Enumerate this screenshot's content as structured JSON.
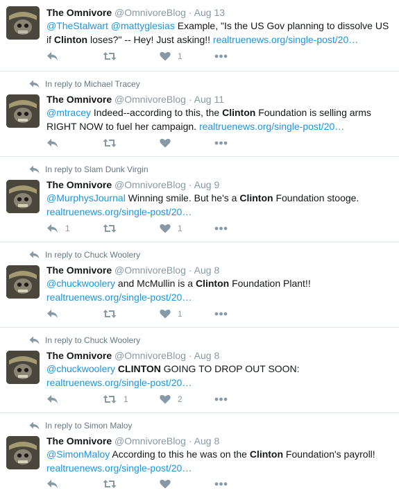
{
  "tweets": [
    {
      "reply_label": "",
      "name": "The Omnivore",
      "handle": "@OmnivoreBlog",
      "date": "Aug 13",
      "segments": [
        {
          "t": "@TheStalwart",
          "k": "mention"
        },
        {
          "t": " ",
          "k": "text"
        },
        {
          "t": "@mattyglesias",
          "k": "mention"
        },
        {
          "t": " Example, \"Is the US Gov planning to dissolve US if ",
          "k": "text"
        },
        {
          "t": "Clinton",
          "k": "bold"
        },
        {
          "t": " loses?\" -- Hey! Just asking!! ",
          "k": "text"
        },
        {
          "t": "realtruenews.org/single-post/20…",
          "k": "url"
        }
      ],
      "reply_count": "",
      "retweet_count": "",
      "like_count": "1"
    },
    {
      "reply_label": "In reply to Michael Tracey",
      "name": "The Omnivore",
      "handle": "@OmnivoreBlog",
      "date": "Aug 11",
      "segments": [
        {
          "t": "@mtracey",
          "k": "mention"
        },
        {
          "t": " Indeed--according to this, the ",
          "k": "text"
        },
        {
          "t": "Clinton",
          "k": "bold"
        },
        {
          "t": " Foundation is selling arms RIGHT NOW to fuel her campaign. ",
          "k": "text"
        },
        {
          "t": "realtruenews.org/single-post/20…",
          "k": "url"
        }
      ],
      "reply_count": "",
      "retweet_count": "",
      "like_count": ""
    },
    {
      "reply_label": "In reply to Slam Dunk Virgin",
      "name": "The Omnivore",
      "handle": "@OmnivoreBlog",
      "date": "Aug 9",
      "segments": [
        {
          "t": "@MurphysJournal",
          "k": "mention"
        },
        {
          "t": " Winning smile. But he's a ",
          "k": "text"
        },
        {
          "t": "Clinton",
          "k": "bold"
        },
        {
          "t": " Foundation stooge. ",
          "k": "text"
        },
        {
          "t": "realtruenews.org/single-post/20…",
          "k": "url"
        }
      ],
      "reply_count": "1",
      "retweet_count": "",
      "like_count": "1"
    },
    {
      "reply_label": "In reply to Chuck Woolery",
      "name": "The Omnivore",
      "handle": "@OmnivoreBlog",
      "date": "Aug 8",
      "segments": [
        {
          "t": "@chuckwoolery",
          "k": "mention"
        },
        {
          "t": " and McMullin is a ",
          "k": "text"
        },
        {
          "t": "Clinton",
          "k": "bold"
        },
        {
          "t": " Foundation Plant!! ",
          "k": "text"
        },
        {
          "t": "realtruenews.org/single-post/20…",
          "k": "url"
        }
      ],
      "reply_count": "",
      "retweet_count": "",
      "like_count": "1"
    },
    {
      "reply_label": "In reply to Chuck Woolery",
      "name": "The Omnivore",
      "handle": "@OmnivoreBlog",
      "date": "Aug 8",
      "segments": [
        {
          "t": "@chuckwoolery",
          "k": "mention"
        },
        {
          "t": " ",
          "k": "text"
        },
        {
          "t": "CLINTON",
          "k": "bold"
        },
        {
          "t": " GOING TO DROP OUT SOON: ",
          "k": "text"
        },
        {
          "t": "realtruenews.org/single-post/20…",
          "k": "url"
        }
      ],
      "reply_count": "",
      "retweet_count": "1",
      "like_count": "2"
    },
    {
      "reply_label": "In reply to Simon Maloy",
      "name": "The Omnivore",
      "handle": "@OmnivoreBlog",
      "date": "Aug 8",
      "segments": [
        {
          "t": "@SimonMaloy",
          "k": "mention"
        },
        {
          "t": " According to this he was on the ",
          "k": "text"
        },
        {
          "t": "Clinton",
          "k": "bold"
        },
        {
          "t": " Foundation's payroll! ",
          "k": "text"
        },
        {
          "t": "realtruenews.org/single-post/20…",
          "k": "url"
        }
      ],
      "reply_count": "",
      "retweet_count": "",
      "like_count": ""
    }
  ],
  "colors": {
    "link": "#1b95e0",
    "meta": "#8899a6",
    "divider": "#e1e8ed",
    "text": "#14171a"
  },
  "icons": {
    "reply_context": "reply-arrow-icon",
    "reply": "reply-icon",
    "retweet": "retweet-icon",
    "like": "heart-icon",
    "more": "more-dots-icon"
  }
}
